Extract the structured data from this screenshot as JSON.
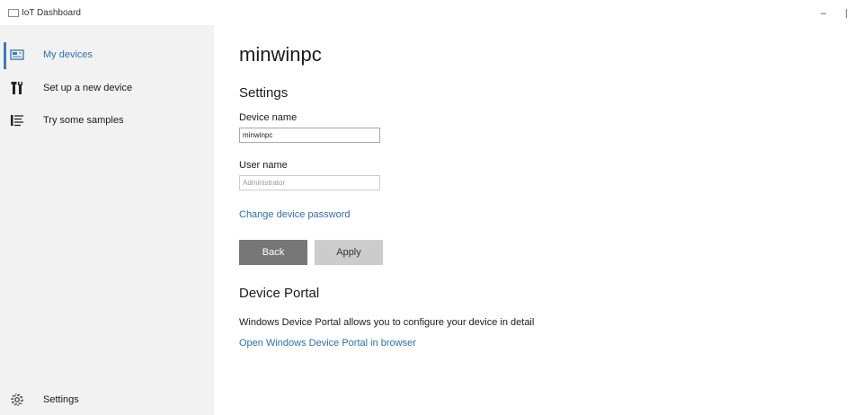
{
  "window": {
    "title": "IoT Dashboard",
    "minimize_glyph": "–"
  },
  "sidebar": {
    "items": [
      {
        "label": "My devices",
        "icon": "device-icon",
        "selected": true
      },
      {
        "label": "Set up a new device",
        "icon": "tools-icon",
        "selected": false
      },
      {
        "label": "Try some samples",
        "icon": "list-icon",
        "selected": false
      }
    ],
    "settings": {
      "label": "Settings",
      "icon": "gear-icon"
    }
  },
  "main": {
    "device_title": "minwinpc",
    "settings_heading": "Settings",
    "device_name": {
      "label": "Device name",
      "value": "minwinpc"
    },
    "user_name": {
      "label": "User name",
      "value": "Administrator"
    },
    "change_password_link": "Change device password",
    "buttons": {
      "back": "Back",
      "apply": "Apply"
    },
    "portal": {
      "heading": "Device Portal",
      "description": "Windows Device Portal allows you to configure your device in detail",
      "open_link": "Open Windows Device Portal in browser"
    }
  },
  "colors": {
    "accent": "#2f6fb0",
    "sidebar_bg": "#f2f2f2",
    "back_button": "#777777",
    "apply_button": "#cccccc"
  }
}
